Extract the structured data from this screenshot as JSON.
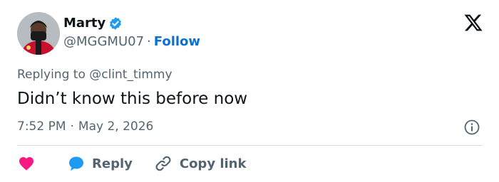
{
  "author": {
    "name": "Marty",
    "handle": "@MGGMU07",
    "separator": "·",
    "follow_label": "Follow"
  },
  "tweet": {
    "replying_to": "Replying to @clint_timmy",
    "text": "Didn’t know this before now",
    "time": "7:52 PM",
    "meta_separator": "·",
    "date": "May 2, 2026"
  },
  "actions": {
    "reply_label": "Reply",
    "copy_link_label": "Copy link"
  },
  "icons": {
    "logo": "x-logo-icon",
    "verified": "verified-badge-icon",
    "info": "info-icon",
    "like": "heart-icon",
    "reply": "speech-bubble-icon",
    "copy": "link-icon"
  },
  "colors": {
    "link": "#0c70d1",
    "verified": "#1d9bf0",
    "heart": "#f91880",
    "muted": "#536471",
    "text": "#0f1419"
  }
}
